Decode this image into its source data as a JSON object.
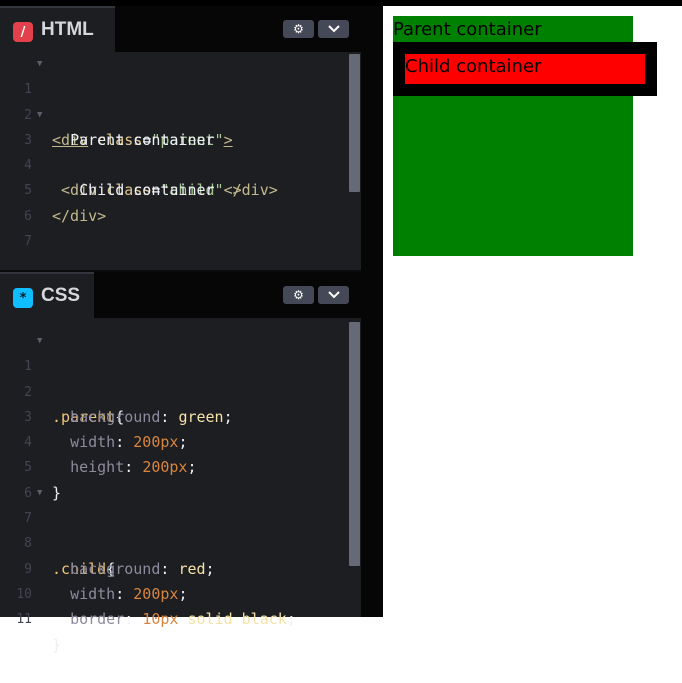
{
  "html_pane": {
    "title": "HTML",
    "icon": "slash-icon",
    "icon_color": "#e2414c",
    "lines": [
      {
        "n": "1",
        "fold": true
      },
      {
        "n": "2",
        "fold": false
      },
      {
        "n": "3",
        "fold": true
      },
      {
        "n": "4",
        "fold": false
      },
      {
        "n": "5",
        "fold": false
      },
      {
        "n": "6",
        "fold": false
      },
      {
        "n": "7",
        "fold": false
      }
    ],
    "code": {
      "l1_open": "<div",
      "l1_attr": "class",
      "l1_eq": "=",
      "l1_str": "\"parent\"",
      "l1_close": ">",
      "l2_text": "Parent container",
      "l3_open": "<div",
      "l3_attr": "class",
      "l3_eq": "=",
      "l3_str": "\"child\"",
      "l3_close": ">",
      "l4_text": "Child container",
      "l4_close": "</div>",
      "l5_close": "</div>"
    }
  },
  "css_pane": {
    "title": "CSS",
    "icon": "asterisk-icon",
    "icon_color": "#0ebeff",
    "lines": [
      {
        "n": "1",
        "fold": true
      },
      {
        "n": "2",
        "fold": false
      },
      {
        "n": "3",
        "fold": false
      },
      {
        "n": "4",
        "fold": false
      },
      {
        "n": "5",
        "fold": false
      },
      {
        "n": "6",
        "fold": false
      },
      {
        "n": "7",
        "fold": true
      },
      {
        "n": "8",
        "fold": false
      },
      {
        "n": "9",
        "fold": false
      },
      {
        "n": "10",
        "fold": false
      },
      {
        "n": "11",
        "fold": false
      }
    ],
    "code": {
      "l1_sel": ".parent",
      "l1_brace": "{",
      "l2_prop": "background",
      "l2_val": "green",
      "l3_prop": "width",
      "l3_val": "200px",
      "l4_prop": "height",
      "l4_val": "200px",
      "l5_brace": "}",
      "l7_sel": ".child",
      "l7_brace": "{",
      "l8_prop": "background",
      "l8_val": "red",
      "l9_prop": "width",
      "l9_val": "200px",
      "l10_prop": "border",
      "l10_num": "10px",
      "l10_val": "solid black",
      "l11_brace": "}"
    }
  },
  "buttons": {
    "settings_icon": "gear-icon",
    "settings_glyph": "⚙",
    "collapse_icon": "chevron-down-icon"
  },
  "preview": {
    "parent_text": "Parent container",
    "child_text": "Child container",
    "parent_color": "#008000",
    "child_color": "#ff0000",
    "border_color": "#000000"
  }
}
